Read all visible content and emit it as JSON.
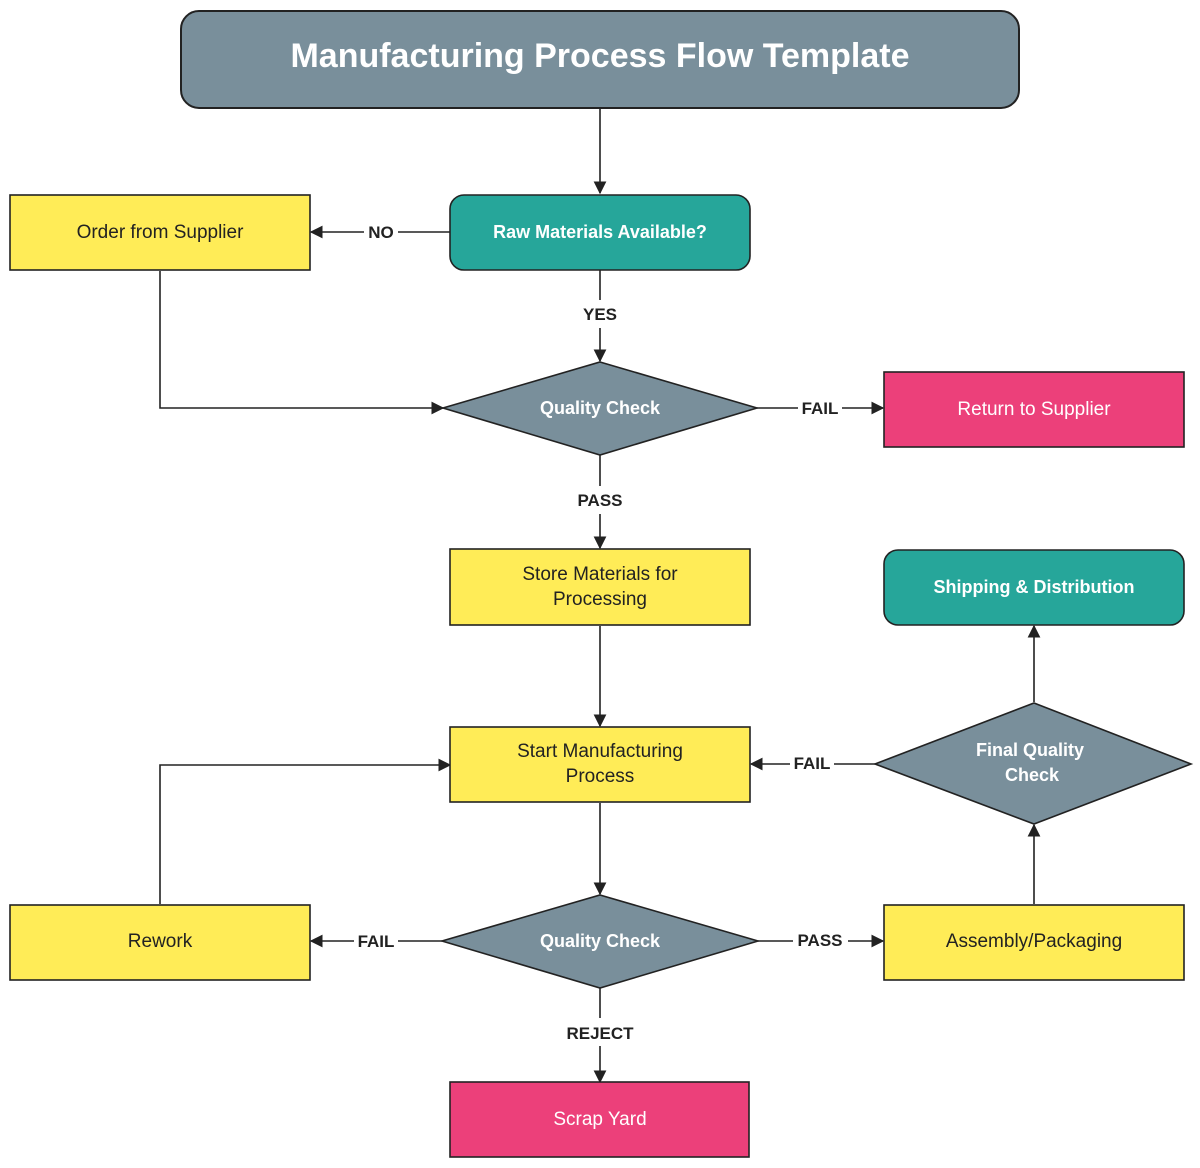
{
  "title": "Manufacturing Process Flow Template",
  "colors": {
    "title_fill": "#798f9b",
    "process_fill": "#ffec57",
    "terminal_green": "#26a69a",
    "decision_fill": "#798f9b",
    "reject_fill": "#ec407a",
    "stroke": "#222222",
    "text_dark": "#222222",
    "text_light": "#ffffff"
  },
  "nodes": {
    "raw_materials": {
      "label": "Raw Materials Available?",
      "shape": "rounded-rect",
      "color": "terminal_green"
    },
    "order_supplier": {
      "label": "Order from Supplier",
      "shape": "rect",
      "color": "process_fill"
    },
    "quality_check_1": {
      "label": "Quality Check",
      "shape": "diamond",
      "color": "decision_fill"
    },
    "return_supplier": {
      "label": "Return to Supplier",
      "shape": "rect",
      "color": "reject_fill"
    },
    "store_materials": {
      "label_line1": "Store Materials for",
      "label_line2": "Processing",
      "shape": "rect",
      "color": "process_fill"
    },
    "shipping": {
      "label": "Shipping & Distribution",
      "shape": "rounded-rect",
      "color": "terminal_green"
    },
    "start_manufacturing": {
      "label_line1": "Start Manufacturing",
      "label_line2": "Process",
      "shape": "rect",
      "color": "process_fill"
    },
    "final_quality_check": {
      "label_line1": "Final Quality",
      "label_line2": "Check",
      "shape": "diamond",
      "color": "decision_fill"
    },
    "rework": {
      "label": "Rework",
      "shape": "rect",
      "color": "process_fill"
    },
    "quality_check_2": {
      "label": "Quality Check",
      "shape": "diamond",
      "color": "decision_fill"
    },
    "assembly": {
      "label": "Assembly/Packaging",
      "shape": "rect",
      "color": "process_fill"
    },
    "scrap_yard": {
      "label": "Scrap Yard",
      "shape": "rect",
      "color": "reject_fill"
    }
  },
  "edges": [
    {
      "from": "title",
      "to": "raw_materials",
      "label": ""
    },
    {
      "from": "raw_materials",
      "to": "order_supplier",
      "label": "NO"
    },
    {
      "from": "raw_materials",
      "to": "quality_check_1",
      "label": "YES"
    },
    {
      "from": "order_supplier",
      "to": "quality_check_1",
      "label": ""
    },
    {
      "from": "quality_check_1",
      "to": "return_supplier",
      "label": "FAIL"
    },
    {
      "from": "quality_check_1",
      "to": "store_materials",
      "label": "PASS"
    },
    {
      "from": "store_materials",
      "to": "start_manufacturing",
      "label": ""
    },
    {
      "from": "start_manufacturing",
      "to": "quality_check_2",
      "label": ""
    },
    {
      "from": "quality_check_2",
      "to": "rework",
      "label": "FAIL"
    },
    {
      "from": "quality_check_2",
      "to": "assembly",
      "label": "PASS"
    },
    {
      "from": "quality_check_2",
      "to": "scrap_yard",
      "label": "REJECT"
    },
    {
      "from": "rework",
      "to": "start_manufacturing",
      "label": ""
    },
    {
      "from": "assembly",
      "to": "final_quality_check",
      "label": ""
    },
    {
      "from": "final_quality_check",
      "to": "start_manufacturing",
      "label": "FAIL"
    },
    {
      "from": "final_quality_check",
      "to": "shipping",
      "label": ""
    }
  ],
  "edge_labels": {
    "no": "NO",
    "yes": "YES",
    "fail_1": "FAIL",
    "pass_1": "PASS",
    "fail_final": "FAIL",
    "fail_2": "FAIL",
    "pass_2": "PASS",
    "reject": "REJECT"
  }
}
